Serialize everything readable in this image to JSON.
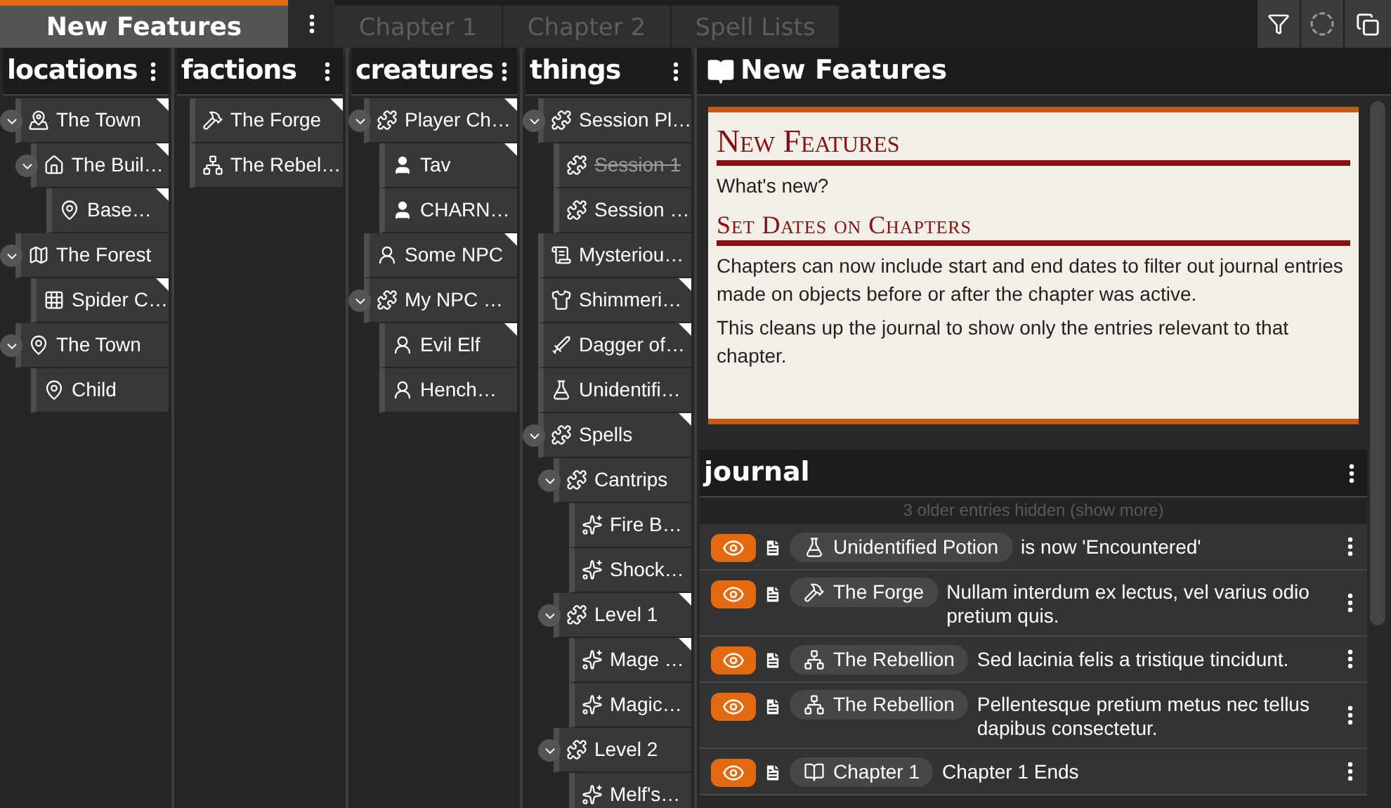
{
  "tabs": [
    {
      "label": "New Features",
      "selected": true
    },
    {
      "label": "Chapter 1",
      "selected": false
    },
    {
      "label": "Chapter 2",
      "selected": false
    },
    {
      "label": "Spell Lists",
      "selected": false
    }
  ],
  "columns": [
    {
      "title": "locations",
      "items": [
        {
          "label": "The Town",
          "kind": "town",
          "flagged": true,
          "struck": false,
          "expanded": true,
          "children": [
            {
              "label": "The Buil…",
              "kind": "building",
              "flagged": true,
              "struck": false,
              "expanded": true,
              "children": [
                {
                  "label": "Base…",
                  "kind": "place",
                  "flagged": true,
                  "struck": false
                }
              ]
            }
          ]
        },
        {
          "label": "The Forest",
          "kind": "region",
          "flagged": false,
          "struck": false,
          "expanded": true,
          "children": [
            {
              "label": "Spider C…",
              "kind": "dungeon",
              "flagged": true,
              "struck": false
            }
          ]
        },
        {
          "label": "The Town",
          "kind": "place",
          "flagged": false,
          "struck": false,
          "expanded": true,
          "children": [
            {
              "label": "Child",
              "kind": "place",
              "flagged": false,
              "struck": false
            }
          ]
        }
      ]
    },
    {
      "title": "factions",
      "items": [
        {
          "label": "The Forge",
          "kind": "workshop",
          "flagged": true,
          "struck": false
        },
        {
          "label": "The Rebel…",
          "kind": "organization",
          "flagged": false,
          "struck": false
        }
      ]
    },
    {
      "title": "creatures",
      "items": [
        {
          "label": "Player Ch…",
          "kind": "group",
          "flagged": true,
          "struck": false,
          "expanded": true,
          "children": [
            {
              "label": "Tav",
              "kind": "player",
              "flagged": true,
              "struck": false
            },
            {
              "label": "CHARN…",
              "kind": "player",
              "flagged": false,
              "struck": false
            }
          ]
        },
        {
          "label": "Some NPC",
          "kind": "npc",
          "flagged": true,
          "struck": false
        },
        {
          "label": "My NPC …",
          "kind": "group",
          "flagged": false,
          "struck": false,
          "expanded": true,
          "children": [
            {
              "label": "Evil Elf",
              "kind": "npc",
              "flagged": true,
              "struck": false
            },
            {
              "label": "Hench…",
              "kind": "npc",
              "flagged": false,
              "struck": false
            }
          ]
        }
      ]
    },
    {
      "title": "things",
      "items": [
        {
          "label": "Session Pl…",
          "kind": "group",
          "flagged": false,
          "struck": false,
          "expanded": true,
          "children": [
            {
              "label": "Session 1",
              "kind": "group",
              "flagged": false,
              "struck": true
            },
            {
              "label": "Session …",
              "kind": "group",
              "flagged": false,
              "struck": false
            }
          ]
        },
        {
          "label": "Mysteriou…",
          "kind": "note",
          "flagged": false,
          "struck": false
        },
        {
          "label": "Shimmeri…",
          "kind": "clothing",
          "flagged": true,
          "struck": false
        },
        {
          "label": "Dagger of…",
          "kind": "weapon",
          "flagged": true,
          "struck": false
        },
        {
          "label": "Unidentifi…",
          "kind": "potion",
          "flagged": false,
          "struck": false
        },
        {
          "label": "Spells",
          "kind": "group",
          "flagged": true,
          "struck": false,
          "expanded": true,
          "children": [
            {
              "label": "Cantrips",
              "kind": "group",
              "flagged": false,
              "struck": false,
              "expanded": true,
              "children": [
                {
                  "label": "Fire B…",
                  "kind": "spell",
                  "flagged": false,
                  "struck": false
                },
                {
                  "label": "Shock…",
                  "kind": "spell",
                  "flagged": false,
                  "struck": false
                }
              ]
            },
            {
              "label": "Level 1",
              "kind": "group",
              "flagged": true,
              "struck": false,
              "expanded": true,
              "children": [
                {
                  "label": "Mage …",
                  "kind": "spell",
                  "flagged": true,
                  "struck": false
                },
                {
                  "label": "Magic…",
                  "kind": "spell",
                  "flagged": false,
                  "struck": false
                }
              ]
            },
            {
              "label": "Level 2",
              "kind": "group",
              "flagged": false,
              "struck": false,
              "expanded": true,
              "children": [
                {
                  "label": "Melf's…",
                  "kind": "spell",
                  "flagged": false,
                  "struck": false
                }
              ]
            }
          ]
        }
      ]
    }
  ],
  "page": {
    "title": "New Features",
    "card": {
      "heading": "New Features",
      "intro": "What's new?",
      "section_heading": "Set Dates on Chapters",
      "paragraphs": [
        "Chapters can now include start and end dates to filter out journal entries made on objects before or after the chapter was active.",
        "This cleans up the journal to show only the entries relevant to that chapter."
      ]
    }
  },
  "journal": {
    "title": "journal",
    "hidden_note": "3 older entries hidden (show more)",
    "entries": [
      {
        "visible": true,
        "subject": {
          "kind": "potion",
          "label": "Unidentified Potion"
        },
        "text": "is now 'Encountered'"
      },
      {
        "visible": true,
        "subject": {
          "kind": "workshop",
          "label": "The Forge"
        },
        "text": "Nullam interdum ex lectus, vel varius odio pretium quis."
      },
      {
        "visible": true,
        "subject": {
          "kind": "organization",
          "label": "The Rebellion"
        },
        "text": "Sed lacinia felis a tristique tincidunt."
      },
      {
        "visible": true,
        "subject": {
          "kind": "organization",
          "label": "The Rebellion"
        },
        "text": "Pellentesque pretium metus nec tellus dapibus consectetur."
      },
      {
        "visible": true,
        "subject": {
          "kind": "chapter",
          "label": "Chapter 1"
        },
        "text": "Chapter 1 Ends"
      }
    ]
  }
}
